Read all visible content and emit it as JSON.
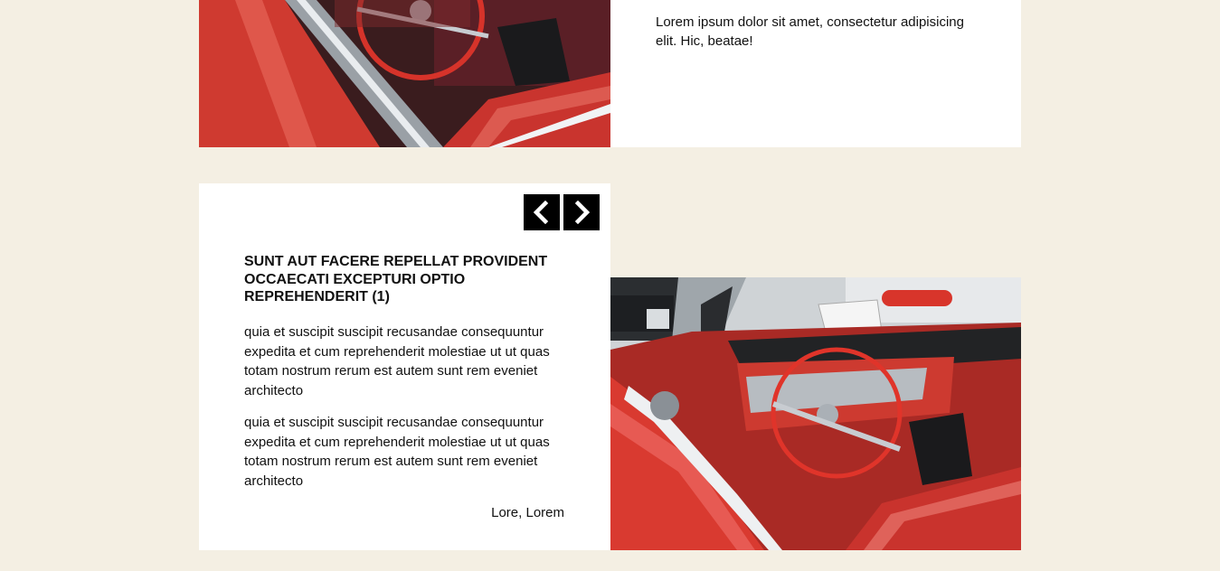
{
  "top_section": {
    "text": "Lorem ipsum dolor sit amet, consectetur adipisicing elit. Hic, beatae!"
  },
  "card": {
    "title": "SUNT AUT FACERE REPELLAT PROVIDENT OCCAECATI EXCEPTURI OPTIO REPREHENDERIT (1)",
    "paragraphs": [
      "quia et suscipit suscipit recusandae consequuntur expedita et cum reprehenderit molestiae ut ut quas totam nostrum rerum est autem sunt rem eveniet architecto",
      "quia et suscipit suscipit recusandae consequuntur expedita et cum reprehenderit molestiae ut ut quas totam nostrum rerum est autem sunt rem eveniet architecto"
    ],
    "author": "Lore, Lorem",
    "nav": {
      "prev_icon": "chevron-left-icon",
      "next_icon": "chevron-right-icon"
    }
  },
  "colors": {
    "page_background": "#f4efe3",
    "panel_background": "#ffffff",
    "nav_button": "#000000",
    "car_red": "#d8352b"
  }
}
